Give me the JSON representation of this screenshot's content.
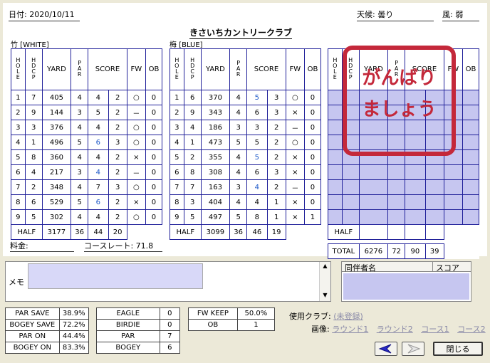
{
  "header": {
    "date": "日付: 2020/10/11",
    "weather": "天候: 曇り",
    "wind": "風: 弱",
    "course_name": "きさいちカントリークラブ"
  },
  "tees": {
    "front": "竹 [WHITE]",
    "back": "梅 [BLUE]"
  },
  "columns": {
    "hole": "HOLE",
    "hdcp": "HDCP",
    "yard": "YARD",
    "par": "PAR",
    "score": "SCORE",
    "fw": "FW",
    "ob": "OB"
  },
  "front_nine": [
    {
      "hole": "1",
      "hdcp": "7",
      "yard": "405",
      "par": "4",
      "score": "4",
      "putt": "2",
      "fw": "○",
      "ob": "0",
      "style": ""
    },
    {
      "hole": "2",
      "hdcp": "9",
      "yard": "144",
      "par": "3",
      "score": "5",
      "putt": "2",
      "fw": "－",
      "ob": "0",
      "style": "bold"
    },
    {
      "hole": "3",
      "hdcp": "3",
      "yard": "376",
      "par": "4",
      "score": "4",
      "putt": "2",
      "fw": "○",
      "ob": "0",
      "style": ""
    },
    {
      "hole": "4",
      "hdcp": "1",
      "yard": "496",
      "par": "5",
      "score": "6",
      "putt": "3",
      "fw": "○",
      "ob": "0",
      "style": "blue"
    },
    {
      "hole": "5",
      "hdcp": "8",
      "yard": "360",
      "par": "4",
      "score": "4",
      "putt": "2",
      "fw": "×",
      "ob": "0",
      "style": ""
    },
    {
      "hole": "6",
      "hdcp": "4",
      "yard": "217",
      "par": "3",
      "score": "4",
      "putt": "2",
      "fw": "－",
      "ob": "0",
      "style": "blue"
    },
    {
      "hole": "7",
      "hdcp": "2",
      "yard": "348",
      "par": "4",
      "score": "7",
      "putt": "3",
      "fw": "○",
      "ob": "0",
      "style": "bold"
    },
    {
      "hole": "8",
      "hdcp": "6",
      "yard": "529",
      "par": "5",
      "score": "6",
      "putt": "2",
      "fw": "×",
      "ob": "0",
      "style": "blue"
    },
    {
      "hole": "9",
      "hdcp": "5",
      "yard": "302",
      "par": "4",
      "score": "4",
      "putt": "2",
      "fw": "○",
      "ob": "0",
      "style": ""
    }
  ],
  "front_half": {
    "label": "HALF",
    "yard": "3177",
    "par": "36",
    "score": "44",
    "putt": "20"
  },
  "back_nine": [
    {
      "hole": "1",
      "hdcp": "6",
      "yard": "370",
      "par": "4",
      "score": "5",
      "putt": "3",
      "fw": "○",
      "ob": "0",
      "style": "blue"
    },
    {
      "hole": "2",
      "hdcp": "9",
      "yard": "343",
      "par": "4",
      "score": "6",
      "putt": "3",
      "fw": "×",
      "ob": "0",
      "style": "bold"
    },
    {
      "hole": "3",
      "hdcp": "4",
      "yard": "186",
      "par": "3",
      "score": "3",
      "putt": "2",
      "fw": "－",
      "ob": "0",
      "style": ""
    },
    {
      "hole": "4",
      "hdcp": "1",
      "yard": "473",
      "par": "5",
      "score": "5",
      "putt": "2",
      "fw": "○",
      "ob": "0",
      "style": ""
    },
    {
      "hole": "5",
      "hdcp": "2",
      "yard": "355",
      "par": "4",
      "score": "5",
      "putt": "2",
      "fw": "×",
      "ob": "0",
      "style": "blue"
    },
    {
      "hole": "6",
      "hdcp": "8",
      "yard": "308",
      "par": "4",
      "score": "6",
      "putt": "3",
      "fw": "×",
      "ob": "0",
      "style": "bold"
    },
    {
      "hole": "7",
      "hdcp": "7",
      "yard": "163",
      "par": "3",
      "score": "4",
      "putt": "2",
      "fw": "－",
      "ob": "0",
      "style": "blue"
    },
    {
      "hole": "8",
      "hdcp": "3",
      "yard": "404",
      "par": "4",
      "score": "4",
      "putt": "1",
      "fw": "×",
      "ob": "0",
      "style": ""
    },
    {
      "hole": "9",
      "hdcp": "5",
      "yard": "497",
      "par": "5",
      "score": "8",
      "putt": "1",
      "fw": "×",
      "ob": "1",
      "style": "bold"
    }
  ],
  "back_half": {
    "label": "HALF",
    "yard": "3099",
    "par": "36",
    "score": "46",
    "putt": "19"
  },
  "extra": {
    "half_label": "HALF",
    "total_label": "TOTAL",
    "total_yard": "6276",
    "total_par": "72",
    "total_score": "90",
    "total_putt": "39",
    "stamp_line1": "がんばり",
    "stamp_line2": "ましょう"
  },
  "footer": {
    "fee_label": "料金:",
    "course_rate": "コースレート:  71.8"
  },
  "memo": {
    "label": "メモ",
    "value": ""
  },
  "companions": {
    "name_header": "同伴者名",
    "score_header": "スコア"
  },
  "stats": {
    "left": [
      {
        "label": "PAR SAVE",
        "value": "38.9%"
      },
      {
        "label": "BOGEY SAVE",
        "value": "72.2%"
      },
      {
        "label": "PAR ON",
        "value": "44.4%"
      },
      {
        "label": "BOGEY ON",
        "value": "83.3%"
      }
    ],
    "middle": [
      {
        "label": "EAGLE",
        "value": "0"
      },
      {
        "label": "BIRDIE",
        "value": "0"
      },
      {
        "label": "PAR",
        "value": "7"
      },
      {
        "label": "BOGEY",
        "value": "6"
      }
    ],
    "right": [
      {
        "label": "FW KEEP",
        "value": "50.0%"
      },
      {
        "label": "OB",
        "value": "1"
      }
    ]
  },
  "club": {
    "label": "使用クラブ:",
    "value": "(未登録)"
  },
  "images": {
    "label": "画像:",
    "links": [
      "ラウンド1",
      "ラウンド2",
      "コース1",
      "コース2"
    ]
  },
  "buttons": {
    "close": "閉じる"
  },
  "colors": {
    "grid": "#1f1f99",
    "highlight": "#1b57c8",
    "stamp": "#c4283a",
    "empty_cell": "#c6c6f0"
  }
}
